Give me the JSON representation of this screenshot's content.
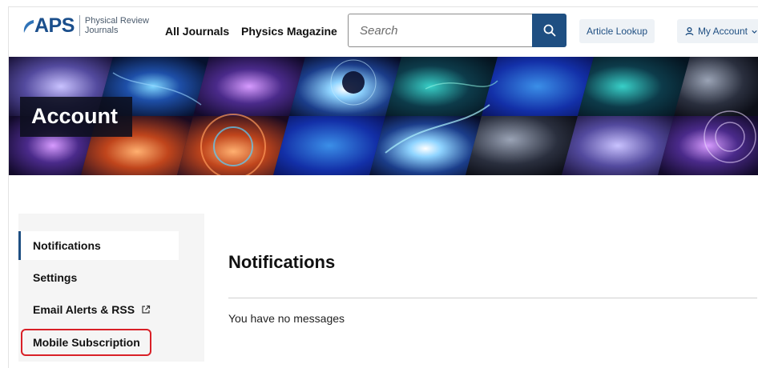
{
  "header": {
    "logo_text": "APS",
    "logo_sub_line1": "Physical Review",
    "logo_sub_line2": "Journals",
    "nav": [
      "All Journals",
      "Physics Magazine"
    ],
    "search_placeholder": "Search",
    "article_lookup_label": "Article Lookup",
    "account_label": "My Account",
    "brand_color": "#1f4f82"
  },
  "banner": {
    "title": "Account"
  },
  "sidebar": {
    "items": [
      {
        "label": "Notifications",
        "active": true
      },
      {
        "label": "Settings",
        "active": false
      },
      {
        "label": "Email Alerts & RSS",
        "active": false,
        "icon": "external-link-icon"
      },
      {
        "label": "Mobile Subscription",
        "active": false,
        "highlighted": true
      }
    ]
  },
  "main": {
    "title": "Notifications",
    "empty_message": "You have no messages"
  }
}
